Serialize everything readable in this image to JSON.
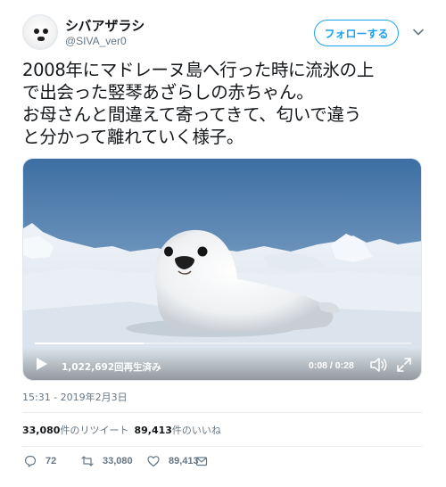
{
  "user": {
    "name": "シバアザラシ",
    "handle": "@SIVA_ver0"
  },
  "header": {
    "follow_label": "フォローする"
  },
  "tweet": {
    "lines": [
      "2008年にマドレーヌ島へ行った時に流氷の上",
      "で出会った竪琴あざらしの赤ちゃん。",
      "お母さんと間違えて寄ってきて、匂いで違う",
      "と分かって離れていく様子。"
    ]
  },
  "video": {
    "views": "1,022,692回再生済み",
    "time": "0:08 / 0:28",
    "progress": 0.29
  },
  "timestamp": "15:31 - 2019年2月3日",
  "stats": {
    "retweets_count": "33,080",
    "retweets_label": "件のリツイート",
    "likes_count": "89,413",
    "likes_label": "件のいいね"
  },
  "actions": {
    "replies": "72",
    "retweets": "33,080",
    "likes": "89,413"
  },
  "colors": {
    "accent": "#1da1f2",
    "secondary_text": "#657786"
  }
}
